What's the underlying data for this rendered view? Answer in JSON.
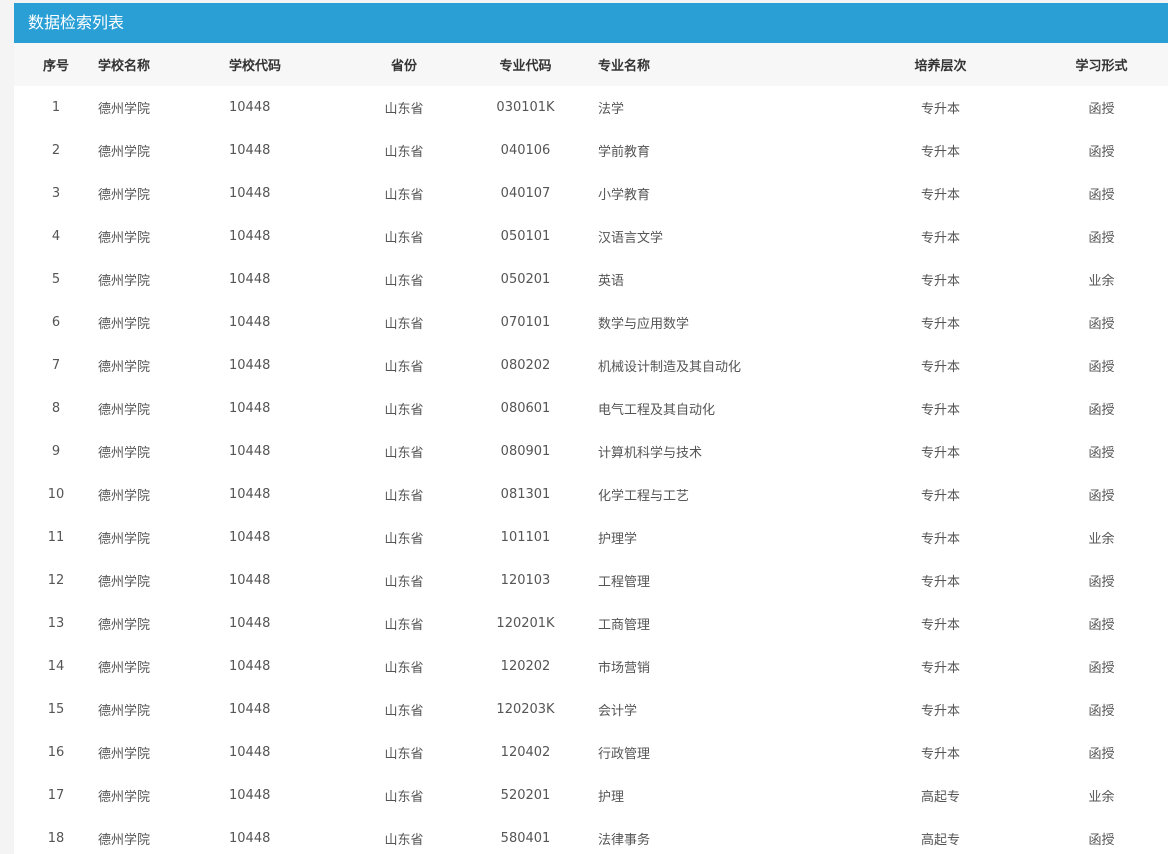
{
  "panel": {
    "title": "数据检索列表"
  },
  "table": {
    "headers": [
      "序号",
      "学校名称",
      "学校代码",
      "省份",
      "专业代码",
      "专业名称",
      "培养层次",
      "学习形式"
    ],
    "rows": [
      [
        "1",
        "德州学院",
        "10448",
        "山东省",
        "030101K",
        "法学",
        "专升本",
        "函授"
      ],
      [
        "2",
        "德州学院",
        "10448",
        "山东省",
        "040106",
        "学前教育",
        "专升本",
        "函授"
      ],
      [
        "3",
        "德州学院",
        "10448",
        "山东省",
        "040107",
        "小学教育",
        "专升本",
        "函授"
      ],
      [
        "4",
        "德州学院",
        "10448",
        "山东省",
        "050101",
        "汉语言文学",
        "专升本",
        "函授"
      ],
      [
        "5",
        "德州学院",
        "10448",
        "山东省",
        "050201",
        "英语",
        "专升本",
        "业余"
      ],
      [
        "6",
        "德州学院",
        "10448",
        "山东省",
        "070101",
        "数学与应用数学",
        "专升本",
        "函授"
      ],
      [
        "7",
        "德州学院",
        "10448",
        "山东省",
        "080202",
        "机械设计制造及其自动化",
        "专升本",
        "函授"
      ],
      [
        "8",
        "德州学院",
        "10448",
        "山东省",
        "080601",
        "电气工程及其自动化",
        "专升本",
        "函授"
      ],
      [
        "9",
        "德州学院",
        "10448",
        "山东省",
        "080901",
        "计算机科学与技术",
        "专升本",
        "函授"
      ],
      [
        "10",
        "德州学院",
        "10448",
        "山东省",
        "081301",
        "化学工程与工艺",
        "专升本",
        "函授"
      ],
      [
        "11",
        "德州学院",
        "10448",
        "山东省",
        "101101",
        "护理学",
        "专升本",
        "业余"
      ],
      [
        "12",
        "德州学院",
        "10448",
        "山东省",
        "120103",
        "工程管理",
        "专升本",
        "函授"
      ],
      [
        "13",
        "德州学院",
        "10448",
        "山东省",
        "120201K",
        "工商管理",
        "专升本",
        "函授"
      ],
      [
        "14",
        "德州学院",
        "10448",
        "山东省",
        "120202",
        "市场营销",
        "专升本",
        "函授"
      ],
      [
        "15",
        "德州学院",
        "10448",
        "山东省",
        "120203K",
        "会计学",
        "专升本",
        "函授"
      ],
      [
        "16",
        "德州学院",
        "10448",
        "山东省",
        "120402",
        "行政管理",
        "专升本",
        "函授"
      ],
      [
        "17",
        "德州学院",
        "10448",
        "山东省",
        "520201",
        "护理",
        "高起专",
        "业余"
      ],
      [
        "18",
        "德州学院",
        "10448",
        "山东省",
        "580401",
        "法律事务",
        "高起专",
        "函授"
      ]
    ]
  },
  "colors": {
    "header_bg": "#2a9fd6",
    "thead_bg": "#f7f7f7"
  }
}
